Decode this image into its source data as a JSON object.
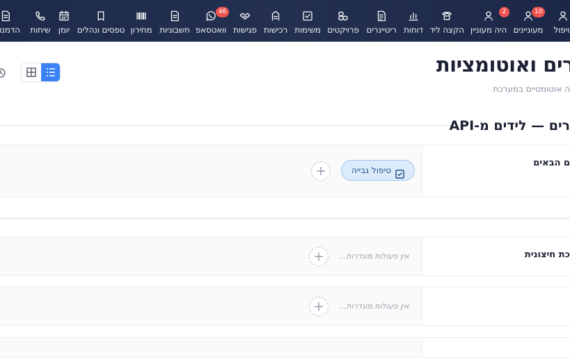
{
  "nav": {
    "items": [
      {
        "label": "טיפול",
        "icon": "user-icon"
      },
      {
        "label": "מעוניינים",
        "icon": "user-icon",
        "badge": "10"
      },
      {
        "label": "היה מעוניין",
        "icon": "user-icon",
        "badge": "2"
      },
      {
        "label": "הקצה ליד",
        "icon": "phone-icon"
      },
      {
        "label": "דוחות",
        "icon": "bar-chart-icon"
      },
      {
        "label": "ריטיינרים",
        "icon": "invoice-icon"
      },
      {
        "label": "פרויקטים",
        "icon": "cubes-icon"
      },
      {
        "label": "משימות",
        "icon": "checkbox-icon"
      },
      {
        "label": "רכישות",
        "icon": "receipt-icon"
      },
      {
        "label": "פגישות",
        "icon": "handshake-icon"
      },
      {
        "label": "וואטסאפ",
        "icon": "whatsapp-icon",
        "badge": "46"
      },
      {
        "label": "חשבוניות",
        "icon": "document-icon"
      },
      {
        "label": "מחירון",
        "icon": "barcode-icon"
      },
      {
        "label": "טפסים ונהלים",
        "icon": "clipboard-icon"
      },
      {
        "label": "יומן",
        "icon": "calendar-icon"
      },
      {
        "label": "שיחות",
        "icon": "phone-call-icon"
      },
      {
        "label": "הדמנו",
        "icon": "document-icon"
      }
    ]
  },
  "page": {
    "title": "רים ואוטומציות",
    "subtitle": "ה אוטומטיים במערכת"
  },
  "section": {
    "title": "רים — לידים מ-API"
  },
  "rows": [
    {
      "name": "ם הבאים",
      "chip_label": "טיפול גבייה"
    },
    {
      "name": "כת חיצונית",
      "empty_label": "אין פעולות מוגדרות..."
    },
    {
      "name": "",
      "empty_label": "אין פעולות מוגדרות..."
    }
  ],
  "colors": {
    "topbar": "#1e2a4a",
    "accent": "#3b82f6",
    "badge": "#ef5350",
    "chip_bg": "#dcebfb"
  }
}
